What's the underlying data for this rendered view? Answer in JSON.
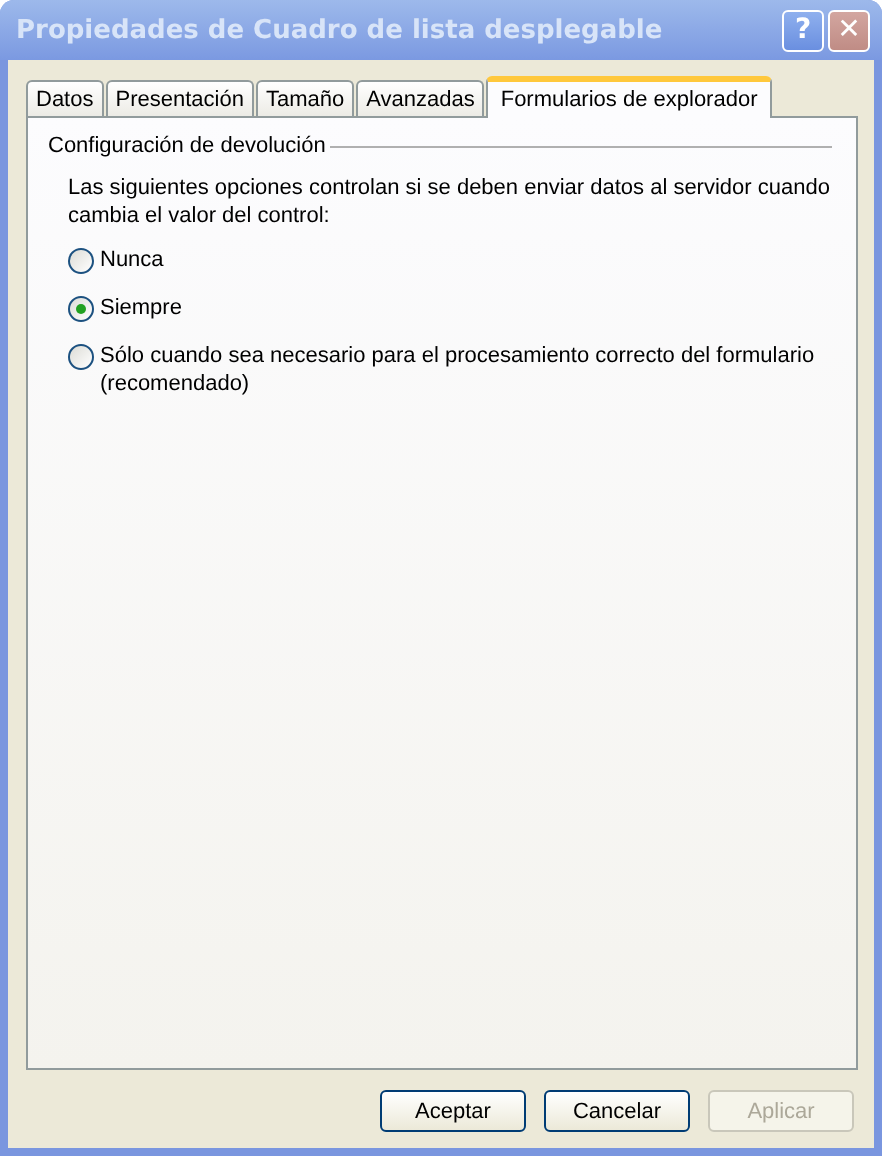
{
  "window": {
    "title": "Propiedades de Cuadro de lista desplegable",
    "active": false
  },
  "title_buttons": [
    {
      "kind": "help",
      "label": "?"
    },
    {
      "kind": "close",
      "label": "✕"
    }
  ],
  "tabs": [
    {
      "label": "Datos",
      "selected": false
    },
    {
      "label": "Presentación",
      "selected": false
    },
    {
      "label": "Tamaño",
      "selected": false
    },
    {
      "label": "Avanzadas",
      "selected": false
    },
    {
      "label": "Formularios de explorador",
      "selected": true
    }
  ],
  "group": {
    "title": "Configuración de devolución",
    "description": "Las siguientes opciones controlan si se deben enviar datos al servidor cuando cambia el valor del control:",
    "options": [
      {
        "label": "Nunca",
        "selected": false
      },
      {
        "label": "Siempre",
        "selected": true
      },
      {
        "label": "Sólo cuando sea necesario para el procesamiento correcto del formulario (recomendado)",
        "selected": false
      }
    ]
  },
  "buttons": [
    {
      "label": "Aceptar",
      "disabled": false
    },
    {
      "label": "Cancelar",
      "disabled": false
    },
    {
      "label": "Aplicar",
      "disabled": true
    }
  ]
}
